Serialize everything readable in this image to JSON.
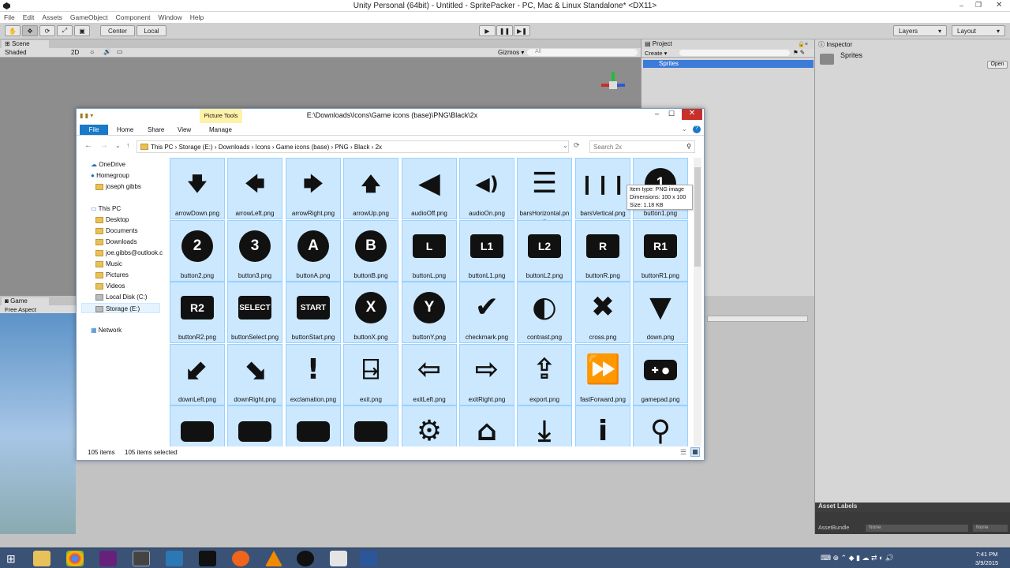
{
  "unity": {
    "title": "Unity Personal (64bit) - Untitled - SpritePacker - PC, Mac & Linux Standalone* <DX11>",
    "menu": [
      "File",
      "Edit",
      "Assets",
      "GameObject",
      "Component",
      "Window",
      "Help"
    ],
    "toolbar": {
      "center": "Center",
      "local": "Local",
      "layers": "Layers",
      "layout": "Layout"
    },
    "scene": {
      "tab": "Scene",
      "shading": "Shaded",
      "mode2d": "2D",
      "gizmos": "Gizmos",
      "search": "All"
    },
    "game": {
      "tab": "Game",
      "aspect": "Free Aspect"
    },
    "project": {
      "tab": "Project",
      "create": "Create",
      "folder": "Sprites"
    },
    "inspector": {
      "tab": "Inspector",
      "name": "Sprites",
      "open": "Open",
      "asset_labels": "Asset Labels",
      "assetbundle_label": "AssetBundle",
      "assetbundle_value": "None",
      "variant_value": "None"
    }
  },
  "explorer": {
    "title": "E:\\Downloads\\Icons\\Game icons (base)\\PNG\\Black\\2x",
    "picture_tools": "Picture Tools",
    "tabs": [
      "File",
      "Home",
      "Share",
      "View",
      "Manage"
    ],
    "breadcrumb": [
      "This PC",
      "Storage (E:)",
      "Downloads",
      "Icons",
      "Game icons (base)",
      "PNG",
      "Black",
      "2x"
    ],
    "search_placeholder": "Search 2x",
    "tree": {
      "onedrive": "OneDrive",
      "homegroup": "Homegroup",
      "user": "joseph gibbs",
      "thispc": "This PC",
      "desktop": "Desktop",
      "documents": "Documents",
      "downloads": "Downloads",
      "email": "joe.gibbs@outlook.c",
      "music": "Music",
      "pictures": "Pictures",
      "videos": "Videos",
      "localdisk": "Local Disk (C:)",
      "storage": "Storage (E:)",
      "network": "Network"
    },
    "files": [
      {
        "name": "arrowDown.png",
        "glyph": "🡇",
        "icon": "arrow-down-icon"
      },
      {
        "name": "arrowLeft.png",
        "glyph": "🡄",
        "icon": "arrow-left-icon"
      },
      {
        "name": "arrowRight.png",
        "glyph": "🡆",
        "icon": "arrow-right-icon"
      },
      {
        "name": "arrowUp.png",
        "glyph": "🡅",
        "icon": "arrow-up-icon"
      },
      {
        "name": "audioOff.png",
        "glyph": "◀",
        "icon": "speaker-off-icon"
      },
      {
        "name": "audioOn.png",
        "glyph": "◀)",
        "icon": "speaker-on-icon"
      },
      {
        "name": "barsHorizontal.png",
        "glyph": "☰",
        "icon": "bars-horizontal-icon"
      },
      {
        "name": "barsVertical.png",
        "glyph": "❙❙❙",
        "icon": "bars-vertical-icon"
      },
      {
        "name": "button1.png",
        "glyph": "1",
        "icon": "button-1-icon"
      },
      {
        "name": "button2.png",
        "glyph": "2",
        "icon": "button-2-icon"
      },
      {
        "name": "button3.png",
        "glyph": "3",
        "icon": "button-3-icon"
      },
      {
        "name": "buttonA.png",
        "glyph": "A",
        "icon": "button-a-icon"
      },
      {
        "name": "buttonB.png",
        "glyph": "B",
        "icon": "button-b-icon"
      },
      {
        "name": "buttonL.png",
        "glyph": "L",
        "icon": "button-l-icon"
      },
      {
        "name": "buttonL1.png",
        "glyph": "L1",
        "icon": "button-l1-icon"
      },
      {
        "name": "buttonL2.png",
        "glyph": "L2",
        "icon": "button-l2-icon"
      },
      {
        "name": "buttonR.png",
        "glyph": "R",
        "icon": "button-r-icon"
      },
      {
        "name": "buttonR1.png",
        "glyph": "R1",
        "icon": "button-r1-icon"
      },
      {
        "name": "buttonR2.png",
        "glyph": "R2",
        "icon": "button-r2-icon"
      },
      {
        "name": "buttonSelect.png",
        "glyph": "SELECT",
        "icon": "button-select-icon"
      },
      {
        "name": "buttonStart.png",
        "glyph": "START",
        "icon": "button-start-icon"
      },
      {
        "name": "buttonX.png",
        "glyph": "X",
        "icon": "button-x-icon"
      },
      {
        "name": "buttonY.png",
        "glyph": "Y",
        "icon": "button-y-icon"
      },
      {
        "name": "checkmark.png",
        "glyph": "✔",
        "icon": "checkmark-icon"
      },
      {
        "name": "contrast.png",
        "glyph": "◐",
        "icon": "contrast-icon"
      },
      {
        "name": "cross.png",
        "glyph": "✖",
        "icon": "cross-icon"
      },
      {
        "name": "down.png",
        "glyph": "▼",
        "icon": "down-icon"
      },
      {
        "name": "downLeft.png",
        "glyph": "⬋",
        "icon": "arrow-down-left-icon"
      },
      {
        "name": "downRight.png",
        "glyph": "⬊",
        "icon": "arrow-down-right-icon"
      },
      {
        "name": "exclamation.png",
        "glyph": "!",
        "icon": "exclamation-icon"
      },
      {
        "name": "exit.png",
        "glyph": "⍈",
        "icon": "exit-icon"
      },
      {
        "name": "exitLeft.png",
        "glyph": "⇦",
        "icon": "exit-left-icon"
      },
      {
        "name": "exitRight.png",
        "glyph": "⇨",
        "icon": "exit-right-icon"
      },
      {
        "name": "export.png",
        "glyph": "⇪",
        "icon": "export-icon"
      },
      {
        "name": "fastForward.png",
        "glyph": "⏩",
        "icon": "fast-forward-icon"
      },
      {
        "name": "gamepad.png",
        "glyph": "✚ ●",
        "icon": "gamepad-icon"
      },
      {
        "name": "",
        "glyph": "",
        "icon": "gamepad-icon"
      },
      {
        "name": "",
        "glyph": "",
        "icon": "gamepad-icon"
      },
      {
        "name": "",
        "glyph": "",
        "icon": "gamepad-icon"
      },
      {
        "name": "",
        "glyph": "",
        "icon": "gamepad-icon"
      },
      {
        "name": "",
        "glyph": "⚙",
        "icon": "gear-icon"
      },
      {
        "name": "",
        "glyph": "⌂",
        "icon": "home-icon"
      },
      {
        "name": "",
        "glyph": "⤓",
        "icon": "import-icon"
      },
      {
        "name": "",
        "glyph": "i",
        "icon": "info-icon"
      },
      {
        "name": "",
        "glyph": "⚲",
        "icon": "joystick-icon"
      }
    ],
    "tooltip": {
      "type": "Item type: PNG image",
      "dimensions": "Dimensions: 100 x 100",
      "size": "Size: 1.18 KB"
    },
    "status": {
      "count": "105 items",
      "selected": "105 items selected"
    }
  },
  "taskbar": {
    "time": "7:41 PM",
    "date": "3/9/2015"
  }
}
